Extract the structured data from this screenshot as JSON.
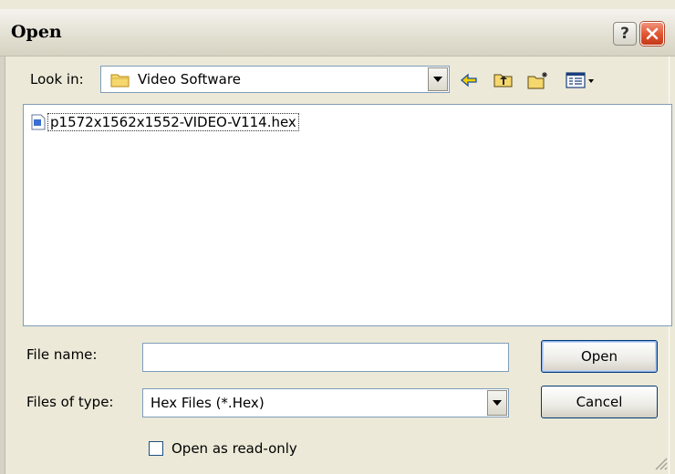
{
  "window": {
    "title": "Open",
    "help_glyph": "?",
    "close_icon": "close-icon"
  },
  "toolbar": {
    "look_in_label": "Look in:",
    "look_in_value": "Video Software",
    "icons": [
      "back-arrow-icon",
      "up-folder-icon",
      "new-folder-icon",
      "view-menu-icon"
    ]
  },
  "files": [
    {
      "name": "p1572x1562x1552-VIDEO-V114.hex",
      "icon": "hex-file-icon"
    }
  ],
  "form": {
    "file_name_label": "File name:",
    "file_name_value": "",
    "files_of_type_label": "Files of type:",
    "files_of_type_value": "Hex Files (*.Hex)",
    "read_only_label": "Open as read-only",
    "read_only_checked": false
  },
  "buttons": {
    "open": "Open",
    "cancel": "Cancel"
  },
  "colors": {
    "dialog_bg": "#ece9d8",
    "close_red": "#e0532f",
    "field_border": "#7f9db9"
  }
}
